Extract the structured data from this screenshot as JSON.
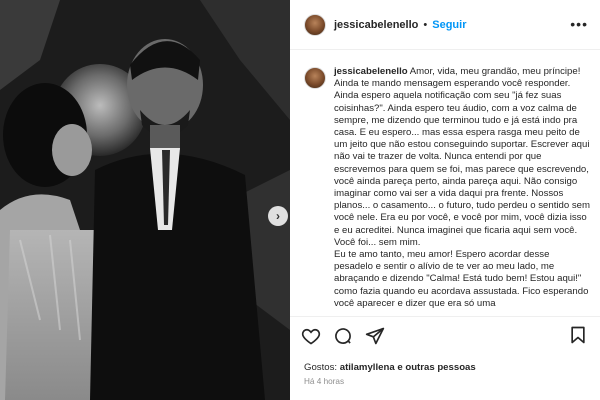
{
  "post": {
    "username": "jessicabelenello",
    "follow_separator": "•",
    "follow_label": "Seguir",
    "more_icon": "more-horizontal-icon"
  },
  "caption": {
    "username": "jessicabelenello",
    "paragraphs": [
      "Amor, vida, meu grandão, meu príncipe! Ainda te mando mensagem esperando você responder. Ainda espero aquela notificação com seu \"já fez suas coisinhas?\". Ainda espero teu áudio, com a voz calma de sempre, me dizendo que terminou tudo e já está indo pra casa. E eu espero... mas essa espera rasga meu peito de um jeito que não estou conseguindo suportar. Escrever aqui não vai te trazer de volta. Nunca entendi por que escrevemos para quem se foi, mas parece que escrevendo, você ainda pareça perto, ainda pareça aqui. Não consigo imaginar como vai ser a vida daqui pra frente. Nossos planos... o casamento... o futuro, tudo perdeu o sentido sem você nele. Era eu por você, e você por mim, você dizia isso e eu acreditei. Nunca imaginei que ficaria aqui sem você. Você foi... sem mim.",
      "Eu te amo tanto, meu amor! Espero acordar desse pesadelo e sentir o alívio de te ver ao meu lado, me abraçando e dizendo \"Calma! Está tudo bem! Estou aqui!\" como fazia quando eu acordava assustada. Fico esperando você aparecer e dizer que era só uma"
    ]
  },
  "likes": {
    "prefix": "Gostos: ",
    "user": "atilamyllena",
    "suffix": " e outras pessoas"
  },
  "timestamp": "Há 4 horas",
  "icons": [
    "heart-icon",
    "comment-icon",
    "share-icon",
    "bookmark-icon",
    "chevron-right-icon"
  ]
}
